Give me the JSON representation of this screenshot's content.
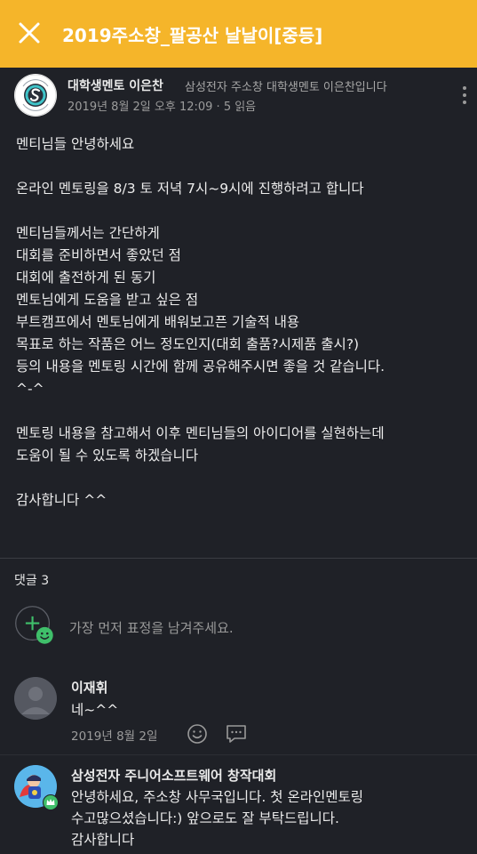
{
  "header": {
    "title": "2019주소창_팔공산 날날이[중등]",
    "accent": "#f5b52a"
  },
  "post": {
    "author_name": "대학생멘토 이은찬",
    "author_desc": "삼성전자 주소창 대학생멘토 이은찬입니다",
    "meta": "2019년 8월 2일 오후 12:09 · 5 읽음",
    "logo_text": "SAMSUNG JUNIOR SOFTWARE CUP",
    "body_lines": [
      "멘티님들 안녕하세요",
      "",
      "온라인 멘토링을 8/3 토 저녁 7시~9시에 진행하려고 합니다",
      "",
      "멘티님들께서는 간단하게",
      "대회를 준비하면서 좋았던 점",
      "대회에 출전하게 된 동기",
      "멘토님에게 도움을 받고 싶은 점",
      "부트캠프에서 멘토님에게 배워보고픈 기술적 내용",
      "목표로 하는 작품은 어느 정도인지(대회 출품?시제품 출시?)",
      "등의 내용을 멘토링 시간에 함께 공유해주시면 좋을 것 같습니다.",
      "^-^",
      "",
      "멘토링 내용을 참고해서 이후 멘티님들의 아이디어를 실현하는데",
      "도움이 될 수 있도록 하겠습니다",
      "",
      "감사합니다 ^^"
    ]
  },
  "comments_section": {
    "count_label": "댓글 3",
    "reaction_prompt": "가장 먼저 표정을 남겨주세요."
  },
  "comments": [
    {
      "name": "이재휘",
      "lines": [
        "네~^^"
      ],
      "date": "2019년 8월 2일"
    },
    {
      "name": "삼성전자 주니어소프트웨어 창작대회",
      "lines": [
        "안녕하세요, 주소창 사무국입니다. 첫 온라인멘토링",
        "수고많으셨습니다:) 앞으로도 잘 부탁드립니다.",
        "감사합니다"
      ]
    }
  ]
}
